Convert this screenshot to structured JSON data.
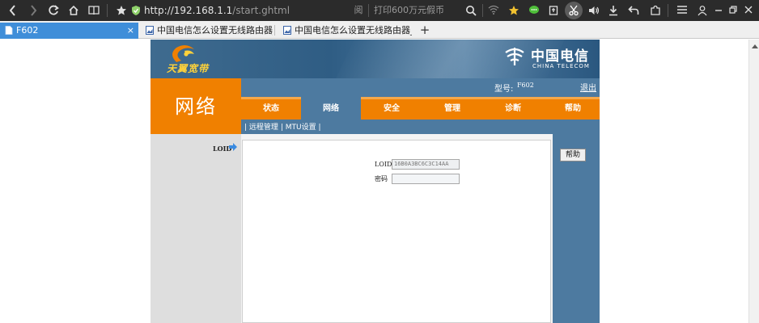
{
  "browser": {
    "address_host": "http://192.168.1.1",
    "address_path": "/start.ghtml",
    "reader_glyph": "阅",
    "promo_text": "打印600万元假币",
    "tabs": [
      {
        "label": "F602",
        "close": "×",
        "active": true
      },
      {
        "label": "中国电信怎么设置无线路由器_百",
        "active": false
      },
      {
        "label": "中国电信怎么设置无线路由器_百",
        "active": false
      }
    ],
    "new_tab": "+"
  },
  "header": {
    "brand_left": "天翼宽带",
    "brand_right_cn": "中国电信",
    "brand_right_en": "CHINA TELECOM"
  },
  "section_title": "网络",
  "infobar": {
    "model_label": "型号:",
    "model_value": "F602",
    "logout": "退出"
  },
  "nav": {
    "items": [
      {
        "label": "状态"
      },
      {
        "label": "网络"
      },
      {
        "label": "安全"
      },
      {
        "label": "管理"
      },
      {
        "label": "诊断"
      },
      {
        "label": "帮助"
      }
    ],
    "active": "网络"
  },
  "subnav": {
    "sep": "|",
    "items": [
      "远程管理",
      "MTU设置"
    ]
  },
  "sidebar": {
    "current": "LOID"
  },
  "form": {
    "loid_label": "LOID",
    "loid_value": "16B0A3BC6C3C14AA",
    "password_label": "密码",
    "password_value": ""
  },
  "help_button": "帮助",
  "colors": {
    "orange": "#f08000",
    "blue": "#4d7aa0",
    "chrome_dark": "#2b2b2b",
    "tab_active": "#3f8ed9"
  }
}
